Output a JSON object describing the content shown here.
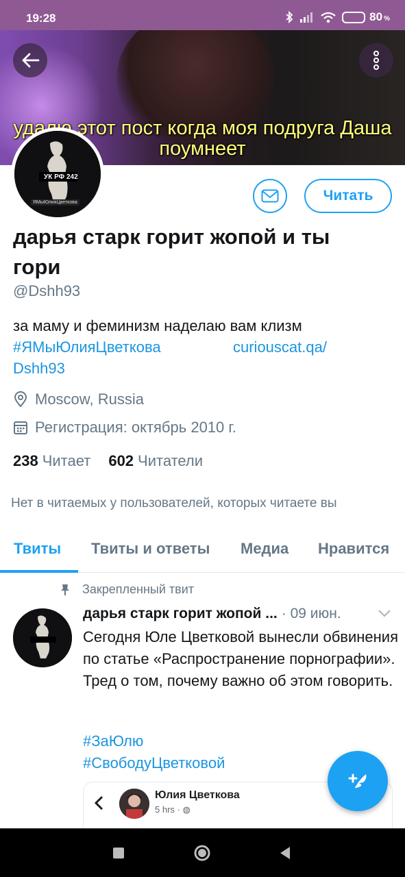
{
  "status_bar": {
    "time": "19:28",
    "battery": "80",
    "battery_unit": "%",
    "battery_level": 0.8
  },
  "banner": {
    "caption_line1": "удалю этот пост когда моя подруга Даша",
    "caption_line2": "поумнеет"
  },
  "header": {
    "back_icon": "arrow-left-icon",
    "more_icon": "more-vertical-icon"
  },
  "profile": {
    "avatar_caption": "УК РФ 242",
    "avatar_label": "ЯМыЮлияЦветкова",
    "display_name": "дарья старк горит жопой и ты гори",
    "handle": "@Dshh93",
    "bio_text": "за маму и феминизм наделаю вам клизм",
    "bio_hashtag": "#ЯМыЮлияЦветкова",
    "bio_link_part1": "curiouscat.qa/",
    "bio_link_part2": "Dshh93",
    "location": "Moscow, Russia",
    "joined": "Регистрация: октябрь 2010 г.",
    "following_count": "238",
    "following_label": "Читает",
    "followers_count": "602",
    "followers_label": "Читатели",
    "no_common_followers": "Нет в читаемых у пользователей, которых читаете вы"
  },
  "actions": {
    "follow_label": "Читать",
    "message_icon": "mail-icon"
  },
  "tabs": [
    {
      "label": "Твиты",
      "active": true
    },
    {
      "label": "Твиты и ответы",
      "active": false
    },
    {
      "label": "Медиа",
      "active": false
    },
    {
      "label": "Нравится",
      "active": false
    }
  ],
  "pinned_tweet": {
    "pinned_label": "Закрепленный твит",
    "author": "дарья старк горит жопой ...",
    "date": "· 09 июн.",
    "text": "Сегодня Юле Цветковой вынесли обвинения по статье «Распространение порнографии». Тред о том, почему важно об этом говорить.",
    "hashtags": [
      "#ЗаЮлю",
      "#СвободуЦветковой"
    ],
    "embed": {
      "name": "Юлия Цветкова",
      "time": "5 hrs ·"
    }
  },
  "compose_icon": "compose-feather-icon",
  "nav": {
    "square": "recent-apps-icon",
    "home": "home-icon",
    "back": "back-triangle-icon"
  },
  "colors": {
    "accent": "#1da1f2",
    "status_bar": "#8f5a93",
    "caption": "#ffff7a",
    "text_secondary": "#657786"
  }
}
